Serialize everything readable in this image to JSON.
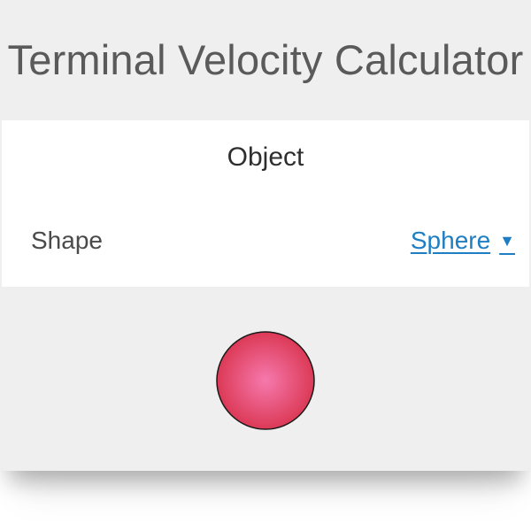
{
  "header": {
    "title": "Terminal Velocity Calculator"
  },
  "object_section": {
    "heading": "Object",
    "shape_field": {
      "label": "Shape",
      "selected_value": "Sphere",
      "dropdown_icon": "caret-down-icon"
    }
  },
  "illustration": {
    "shape_icon": "sphere-icon",
    "colors": {
      "highlight": "#f679ad",
      "base": "#d9334d",
      "outline": "#1a1a1a"
    }
  },
  "theme": {
    "background": "#efefef",
    "panel": "#ffffff",
    "accent": "#1f7ec2",
    "title_text": "#5a5a5a"
  }
}
